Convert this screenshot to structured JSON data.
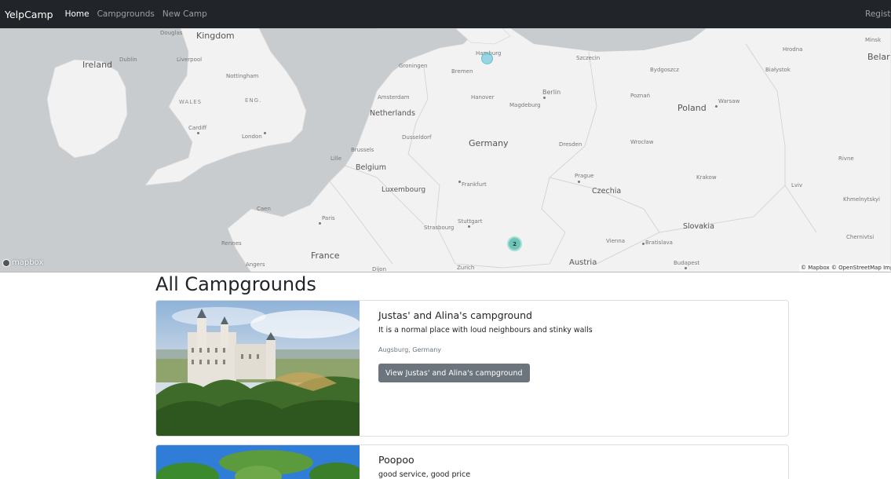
{
  "navbar": {
    "brand": "YelpCamp",
    "links": [
      {
        "label": "Home",
        "active": true
      },
      {
        "label": "Campgrounds",
        "active": false
      },
      {
        "label": "New Camp",
        "active": false
      }
    ],
    "right_link": "Registe"
  },
  "map": {
    "countries": [
      "Kingdom",
      "Ireland",
      "Netherlands",
      "Belgium",
      "Luxembourg",
      "Germany",
      "Poland",
      "Czechia",
      "Slovakia",
      "Austria",
      "France",
      "Belar"
    ],
    "regions": [
      "WALES",
      "ENG."
    ],
    "cities": [
      "Douglas",
      "Dublin",
      "Liverpool",
      "Nottingham",
      "Cardiff",
      "London",
      "Groningen",
      "Bremen",
      "Hamburg",
      "Amsterdam",
      "Hanover",
      "Magdeburg",
      "Berlin",
      "Szczecin",
      "Bydgoszcz",
      "Poznań",
      "Warsaw",
      "Białystok",
      "Hrodna",
      "Minsk",
      "Dusseldorf",
      "Brussels",
      "Lille",
      "Dresden",
      "Wrocław",
      "Frankfurt",
      "Prague",
      "Krakow",
      "Lviv",
      "Rivne",
      "Khmelnytskyi",
      "Caen",
      "Paris",
      "Stuttgart",
      "Strasbourg",
      "Vienna",
      "Bratislava",
      "Budapest",
      "Chernivtsi",
      "Rennes",
      "Angers",
      "Dijon",
      "Zurich"
    ],
    "cluster_count": "2",
    "logo": "mapbox",
    "attribution": "© Mapbox © OpenStreetMap  Impr"
  },
  "page_title": "All Campgrounds",
  "campgrounds": [
    {
      "title": "Justas' and Alina's campground",
      "description": "It is a normal place with loud neighbours and stinky walls",
      "location": "Augsburg, Germany",
      "button": "View Justas' and Alina's campground"
    },
    {
      "title": "Poopoo",
      "description": "good service, good price"
    }
  ],
  "colors": {
    "navbar_bg": "#212529",
    "button_bg": "#6c757d",
    "cluster": "#6cc5b9",
    "water": "#c8ccce",
    "land": "#f2f2f2"
  }
}
